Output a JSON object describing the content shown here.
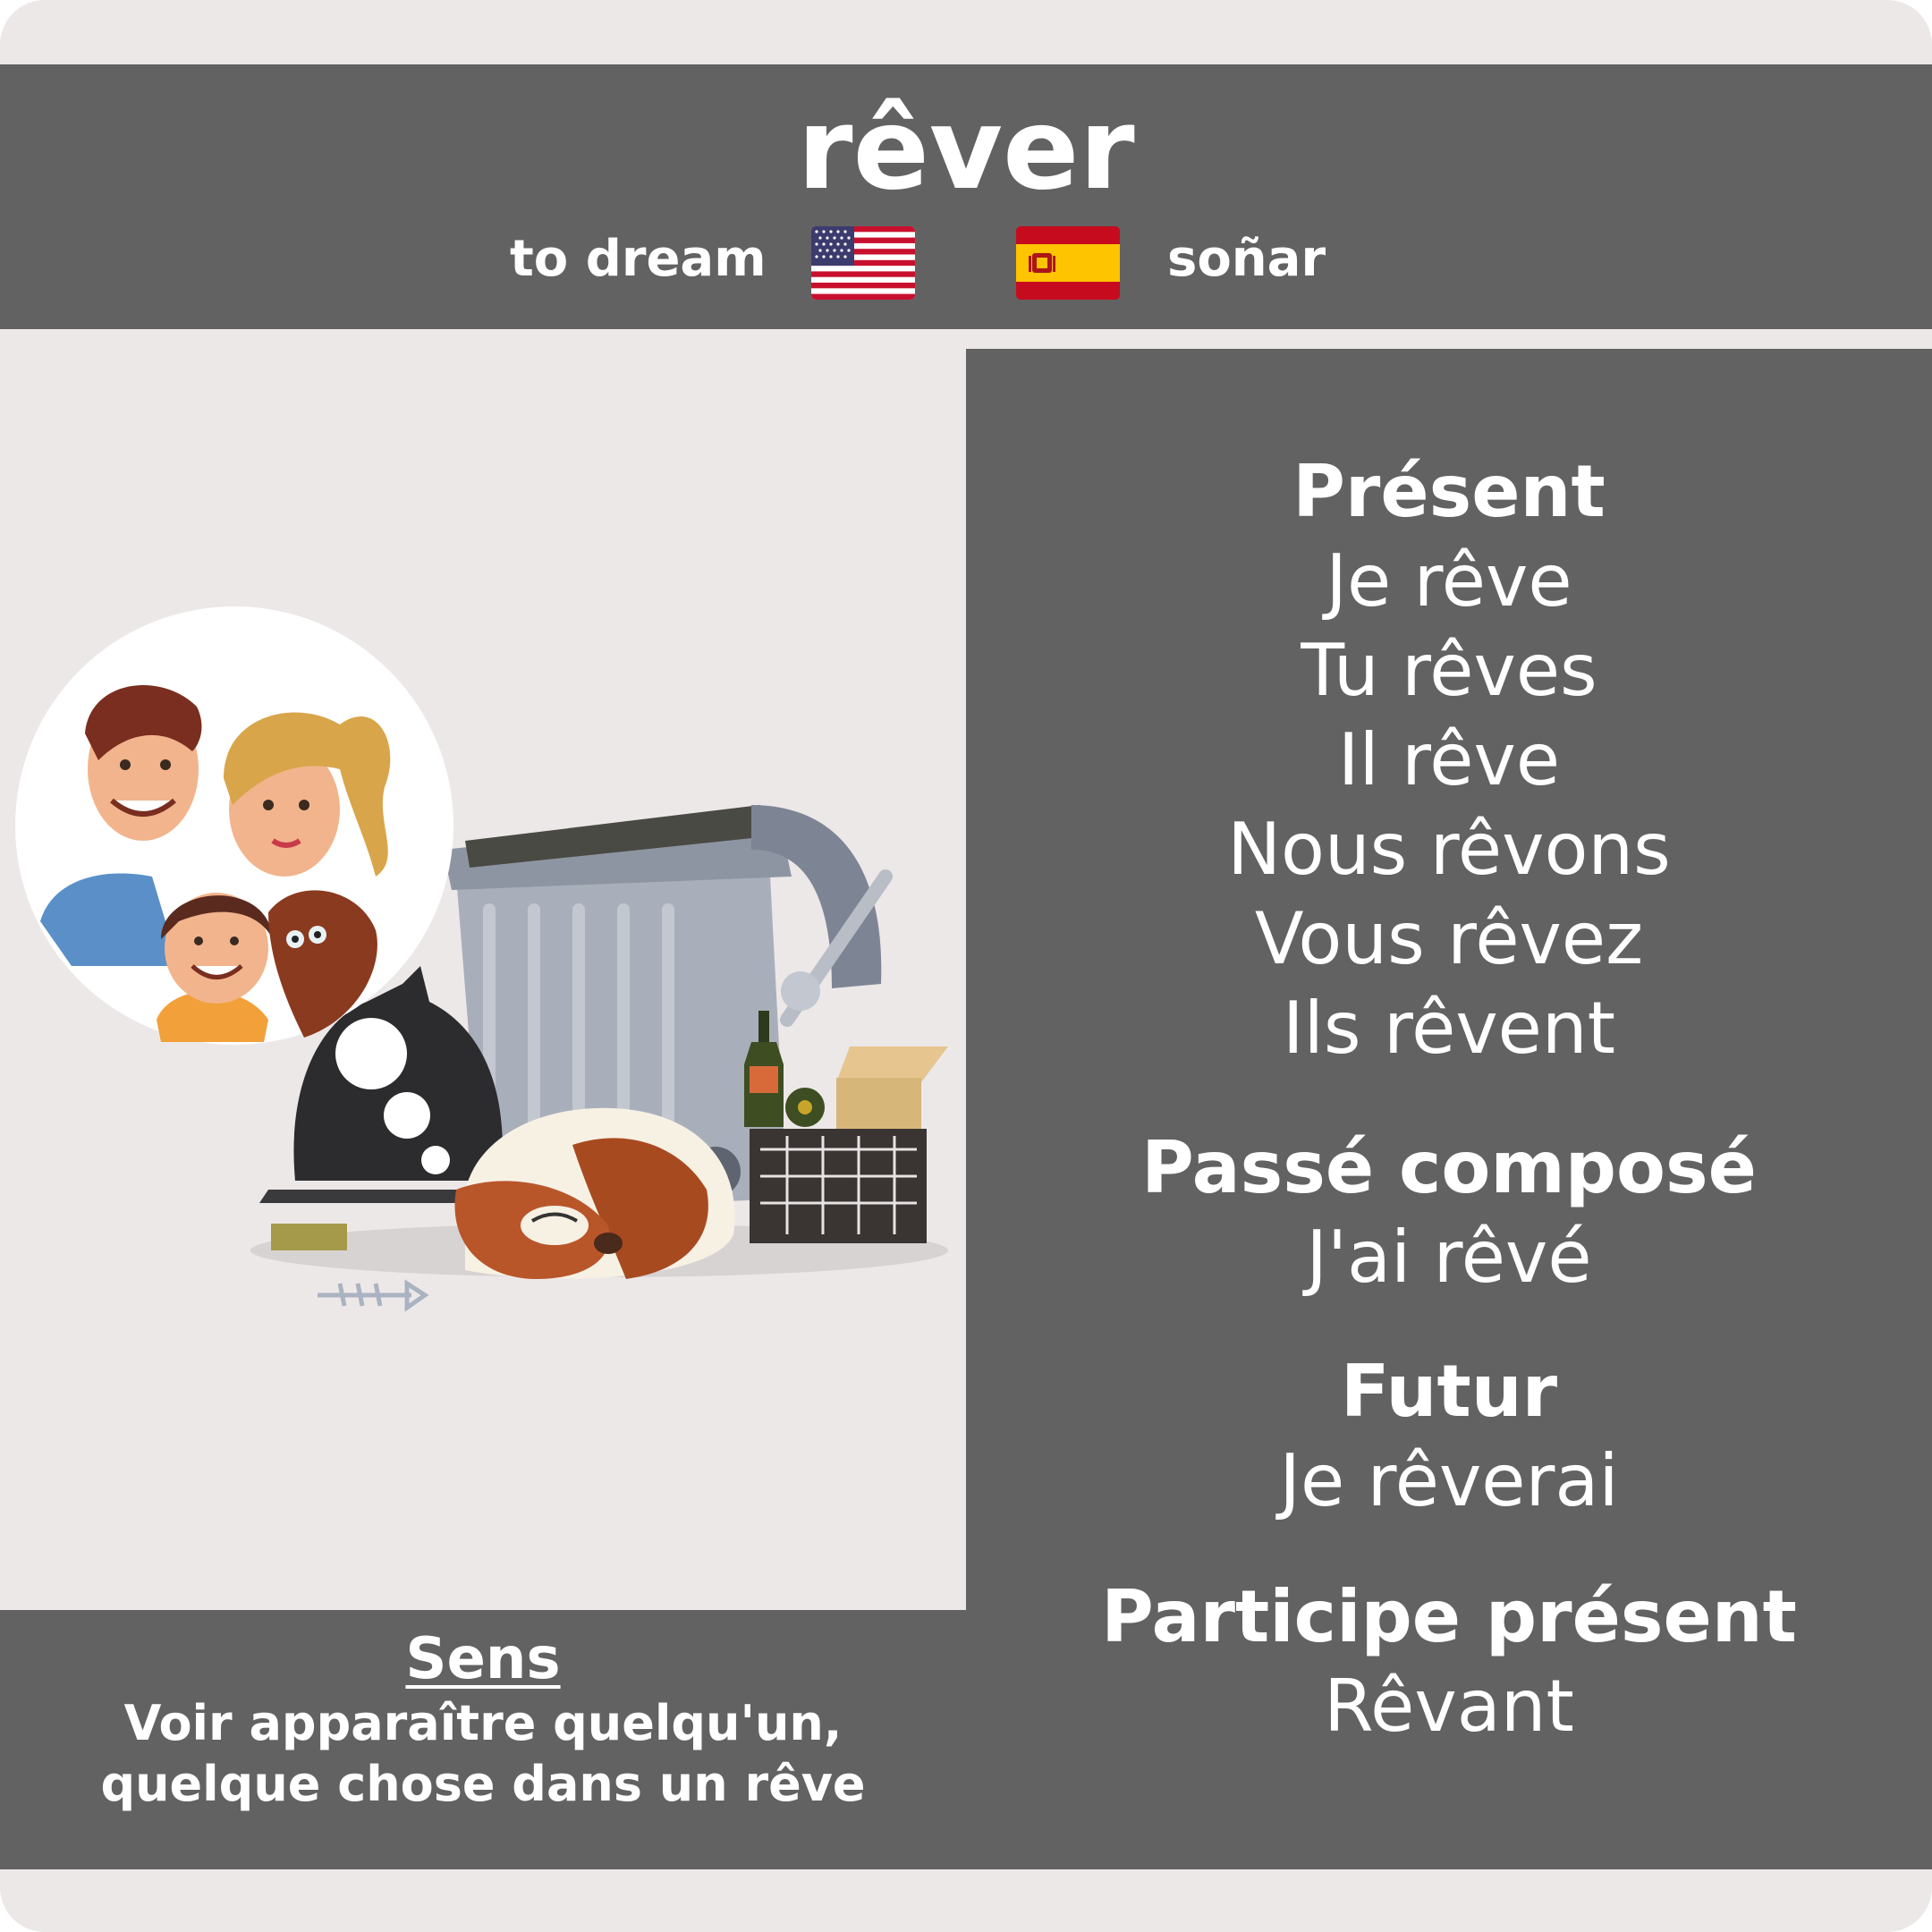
{
  "verb": "rêver",
  "translations": {
    "english": "to dream",
    "spanish": "soñar"
  },
  "flags": {
    "english": "us-flag-icon",
    "spanish": "spain-flag-icon"
  },
  "meaning": {
    "title": "Sens",
    "line1": "Voir apparaître quelqu'un,",
    "line2": "quelque chose dans un rêve"
  },
  "present": {
    "title": "Présent",
    "forms": [
      "Je rêve",
      "Tu rêves",
      "Il rêve",
      "Nous rêvons",
      "Vous rêvez",
      "Ils rêvent"
    ]
  },
  "passe_compose": {
    "title": "Passé composé",
    "form": "J'ai rêvé"
  },
  "futur": {
    "title": "Futur",
    "form": "Je rêverai"
  },
  "participe_present": {
    "title": "Participe présent",
    "form": "Rêvant"
  },
  "colors": {
    "panel": "#636263",
    "background": "#ede8e8",
    "text": "#ffffff"
  }
}
